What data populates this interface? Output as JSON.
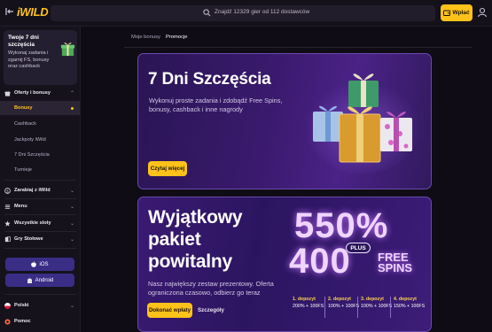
{
  "header": {
    "logo": "iWILD",
    "search_placeholder": "Znajdź 12329 gier od 112 dostawców",
    "deposit_label": "Wpłać"
  },
  "sidebar": {
    "promo_card": {
      "title": "Twoje 7 dni szczęścia",
      "desc": "Wykonaj zadania i zgarnij FS, bonusy oraz cashback"
    },
    "sections": {
      "offers": "Oferty i bonusy",
      "earn": "Zarabiaj z iWild",
      "menu": "Menu",
      "all_slots": "Wszystkie sloty",
      "table_games": "Gry Stołowe"
    },
    "sub_items": [
      "Bonusy",
      "Cashback",
      "Jackpoty iWild",
      "7 Dni Szczęścia",
      "Turnieje"
    ],
    "ios_label": "iOS",
    "android_label": "Android",
    "language": "Polski",
    "help": "Pomoc"
  },
  "main": {
    "tabs": [
      "Moje bonusy",
      "Promocje"
    ],
    "active_tab": "Promocje",
    "banner1": {
      "title": "7 Dni Szczęścia",
      "desc": "Wykonuj proste zadania i zdobądź Free Spins, bonusy, cashback i inne nagrody",
      "cta": "Czytaj więcej"
    },
    "banner2": {
      "title": "Wyjątkowy pakiet powitalny",
      "desc": "Nasz największy zestaw prezentowy. Oferta ograniczona czasowo, odbierz go teraz",
      "cta": "Dokonać wpłaty",
      "link": "Szczegóły",
      "big_top": "550%",
      "plus": "PLUS",
      "big_bottom": "400",
      "free": "FREE",
      "spins": "SPINS",
      "deposits": [
        {
          "label": "1. depozyt",
          "value": "200% + 100FS"
        },
        {
          "label": "2. depozyt",
          "value": "100% + 100FS"
        },
        {
          "label": "3. depozyt",
          "value": "100% + 100FS"
        },
        {
          "label": "4. depozyt",
          "value": "150% + 100FS"
        }
      ]
    }
  },
  "colors": {
    "accent": "#ffc21a",
    "purple": "#3a2d86"
  }
}
